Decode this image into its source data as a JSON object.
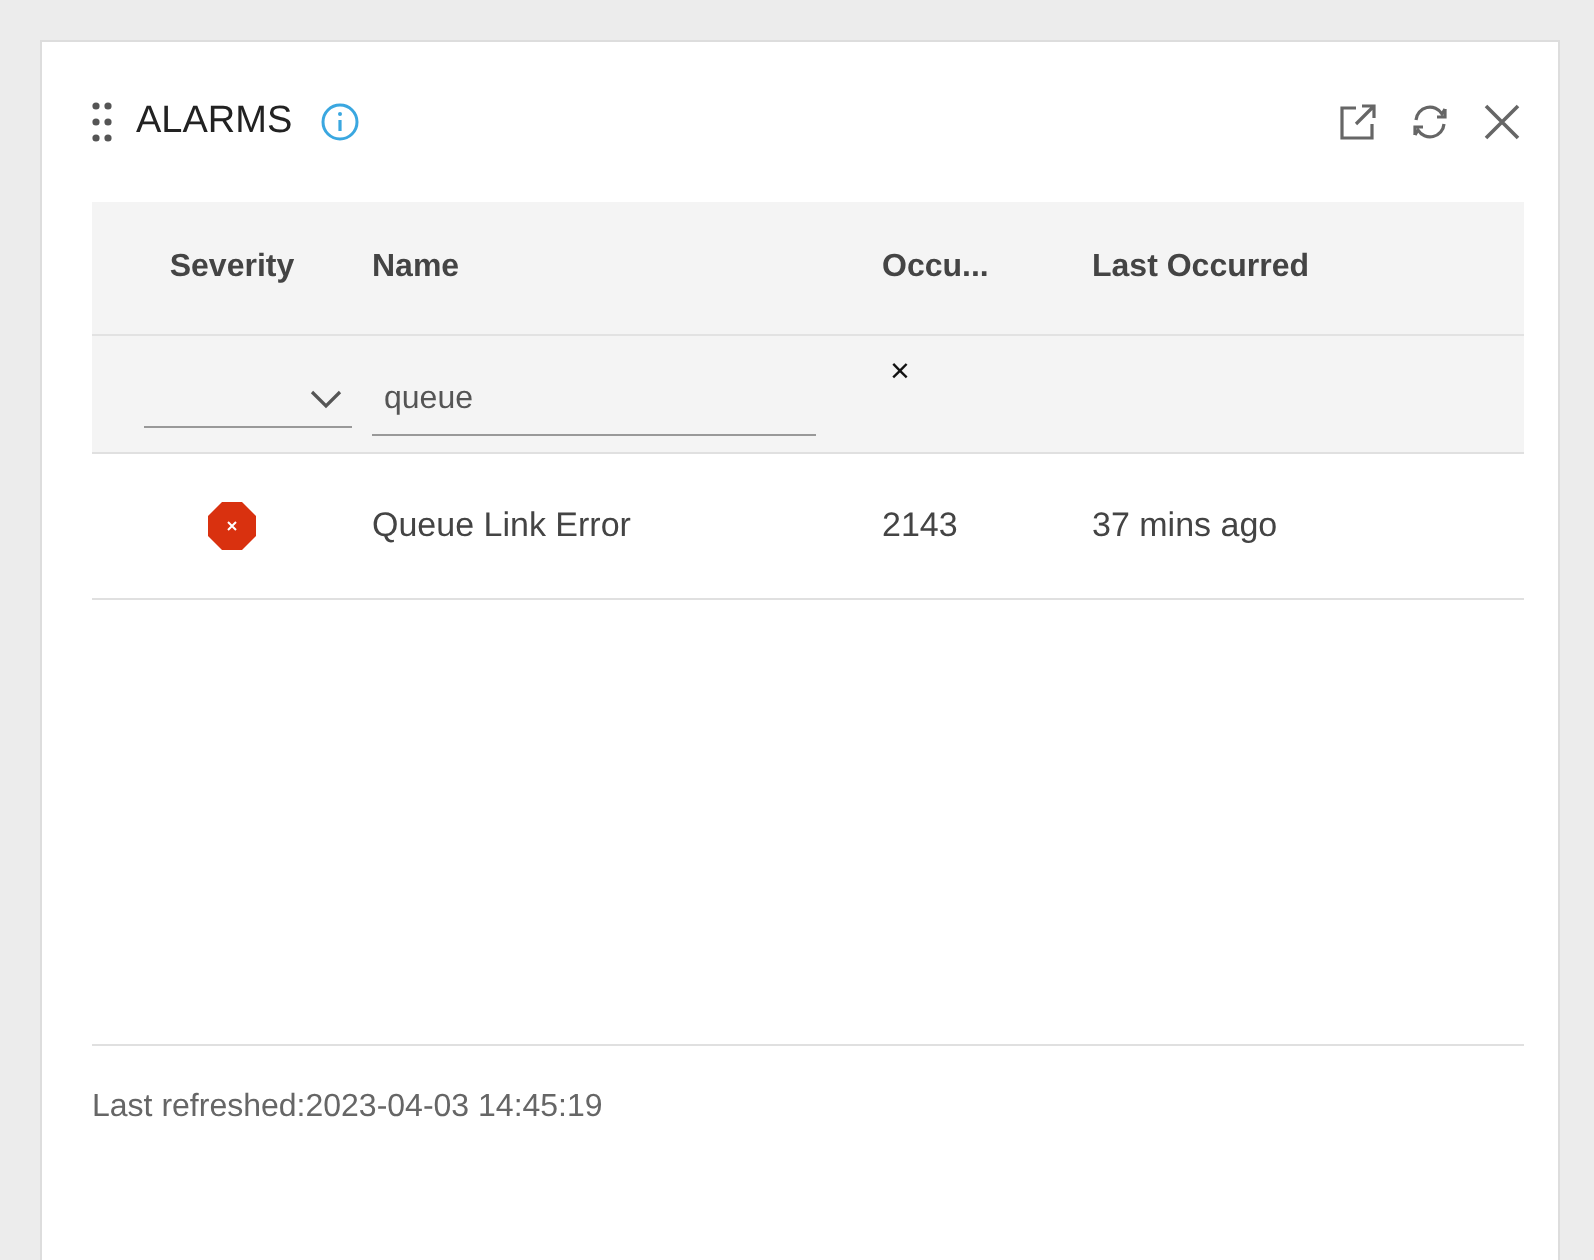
{
  "panel": {
    "title": "ALARMS"
  },
  "table": {
    "columns": [
      "Severity",
      "Name",
      "Occu...",
      "Last Occurred"
    ],
    "filters": {
      "name_value": "queue",
      "clear": "×"
    },
    "rows": [
      {
        "color": "#d9310f",
        "name": "Queue Link Error",
        "occurrences": "2143",
        "last_occurred": "37 mins ago"
      }
    ]
  },
  "footer": {
    "text": "Last refreshed:2023-04-03 14:45:19"
  }
}
